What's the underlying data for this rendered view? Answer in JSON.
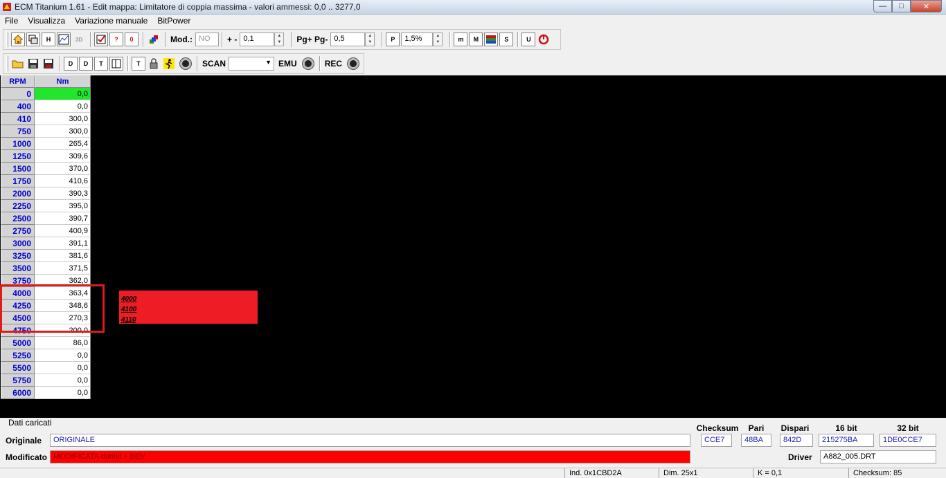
{
  "window": {
    "title": "ECM Titanium 1.61 - Edit mappa: Limitatore di coppia massima - valori ammessi: 0,0 .. 3277,0",
    "min_glyph": "—",
    "max_glyph": "□",
    "close_glyph": "✕"
  },
  "menu": [
    "File",
    "Visualizza",
    "Variazione manuale",
    "BitPower"
  ],
  "toolbar1": {
    "mod_label": "Mod.:",
    "mod_value": "NO",
    "plusminus_label": "+ -",
    "plusminus_value": "0,1",
    "pg_label": "Pg+ Pg-",
    "pg_value": "0,5",
    "percent_value": "1,5%"
  },
  "toolbar2": {
    "scan_label": "SCAN",
    "scan_value": "",
    "emu_label": "EMU",
    "rec_label": "REC"
  },
  "map": {
    "col_rpm": "RPM",
    "col_nm": "Nm",
    "rows": [
      {
        "rpm": "0",
        "nm": "0,0"
      },
      {
        "rpm": "400",
        "nm": "0,0"
      },
      {
        "rpm": "410",
        "nm": "300,0"
      },
      {
        "rpm": "750",
        "nm": "300,0"
      },
      {
        "rpm": "1000",
        "nm": "265,4"
      },
      {
        "rpm": "1250",
        "nm": "309,6"
      },
      {
        "rpm": "1500",
        "nm": "370,0"
      },
      {
        "rpm": "1750",
        "nm": "410,6"
      },
      {
        "rpm": "2000",
        "nm": "390,3"
      },
      {
        "rpm": "2250",
        "nm": "395,0"
      },
      {
        "rpm": "2500",
        "nm": "390,7"
      },
      {
        "rpm": "2750",
        "nm": "400,9"
      },
      {
        "rpm": "3000",
        "nm": "391,1"
      },
      {
        "rpm": "3250",
        "nm": "381,6"
      },
      {
        "rpm": "3500",
        "nm": "371,5"
      },
      {
        "rpm": "3750",
        "nm": "362,0"
      },
      {
        "rpm": "4000",
        "nm": "363,4"
      },
      {
        "rpm": "4250",
        "nm": "348,6"
      },
      {
        "rpm": "4500",
        "nm": "270,3"
      },
      {
        "rpm": "4750",
        "nm": "200,0"
      },
      {
        "rpm": "5000",
        "nm": "86,0"
      },
      {
        "rpm": "5250",
        "nm": "0,0"
      },
      {
        "rpm": "5500",
        "nm": "0,0"
      },
      {
        "rpm": "5750",
        "nm": "0,0"
      },
      {
        "rpm": "6000",
        "nm": "0,0"
      }
    ]
  },
  "popup": [
    "4000",
    "4100",
    "4110"
  ],
  "bottom": {
    "section_title": "Dati caricati",
    "originale_label": "Originale",
    "originale_value": "ORIGINALE",
    "modificato_label": "Modificato",
    "modificato_value": "MODIFICATA daniel + BEV",
    "checksum_head": "Checksum",
    "pari_head": "Pari",
    "dispari_head": "Dispari",
    "bit16_head": "16 bit",
    "bit32_head": "32 bit",
    "checksum_value": "CCE7",
    "pari_value": "48BA",
    "dispari_value": "842D",
    "bit16_value": "215275BA",
    "bit32_value": "1DE0CCE7",
    "driver_label": "Driver",
    "driver_value": "A882_005.DRT"
  },
  "status": {
    "ind": "Ind. 0x1CBD2A",
    "dim": "Dim. 25x1",
    "k": "K = 0,1",
    "checksum": "Checksum: 85"
  },
  "colors": {
    "selected_cell": "#22e62c",
    "highlight": "#e21a1a",
    "popup_bg": "#ee1c24",
    "modified_field": "#ff0000"
  }
}
